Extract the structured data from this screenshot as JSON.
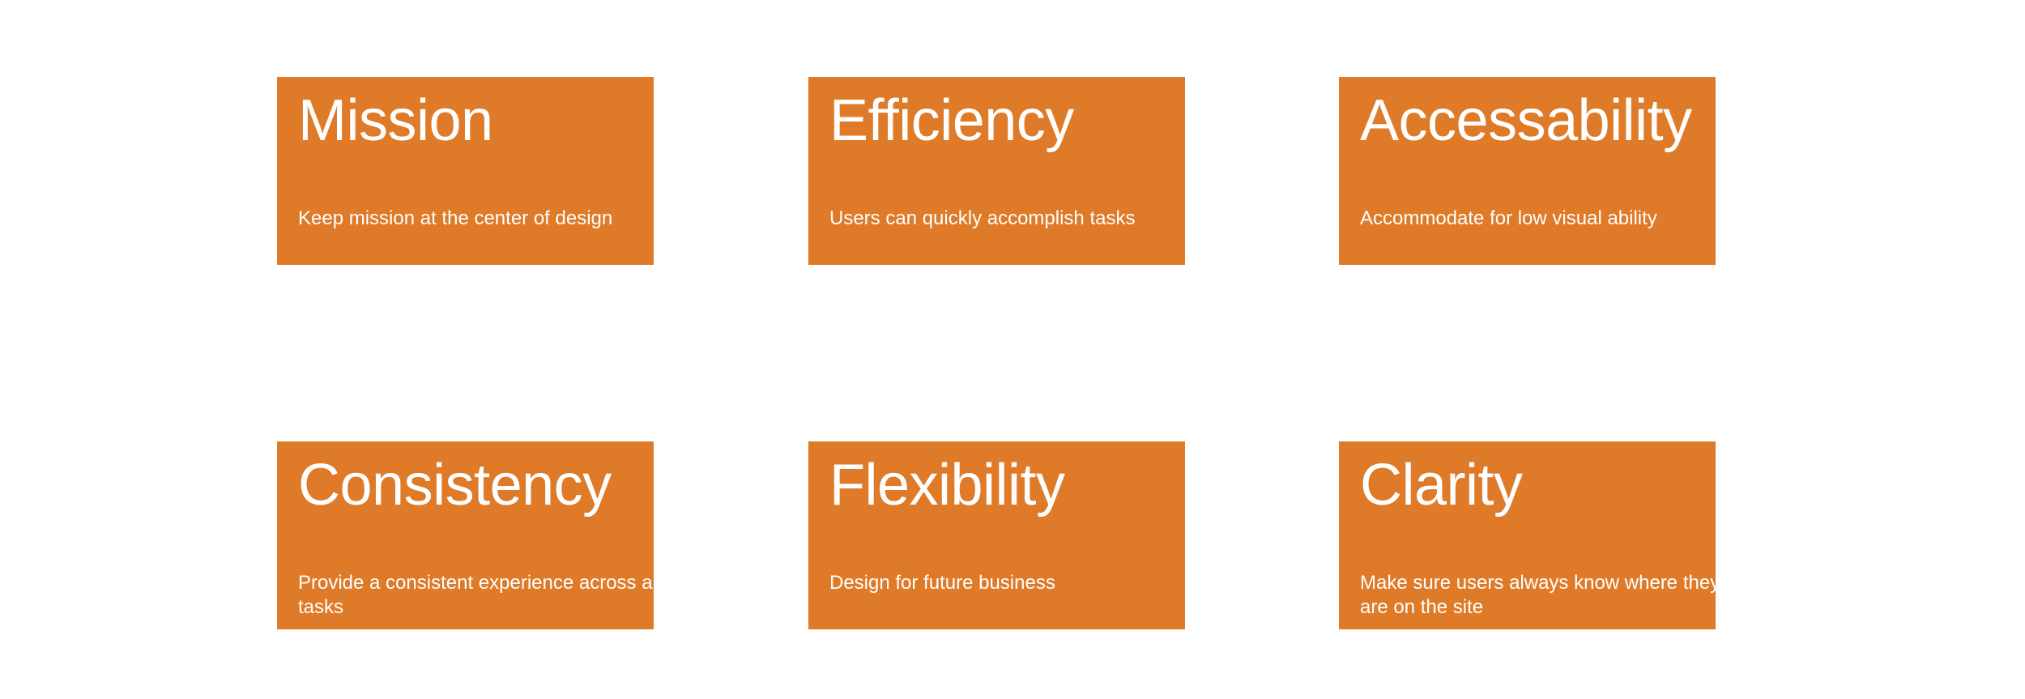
{
  "colors": {
    "card_background": "#df7a28",
    "text": "#ffffff",
    "page_background": "#ffffff"
  },
  "cards": [
    {
      "title": "Mission",
      "description": "Keep mission at the center of design"
    },
    {
      "title": "Efficiency",
      "description": "Users can quickly accomplish tasks"
    },
    {
      "title": "Accessability",
      "description": "Accommodate for low visual ability"
    },
    {
      "title": "Consistency",
      "description": "Provide a consistent experience across all tasks"
    },
    {
      "title": "Flexibility",
      "description": "Design for future business"
    },
    {
      "title": "Clarity",
      "description": "Make sure users always know where they are on the site"
    }
  ]
}
